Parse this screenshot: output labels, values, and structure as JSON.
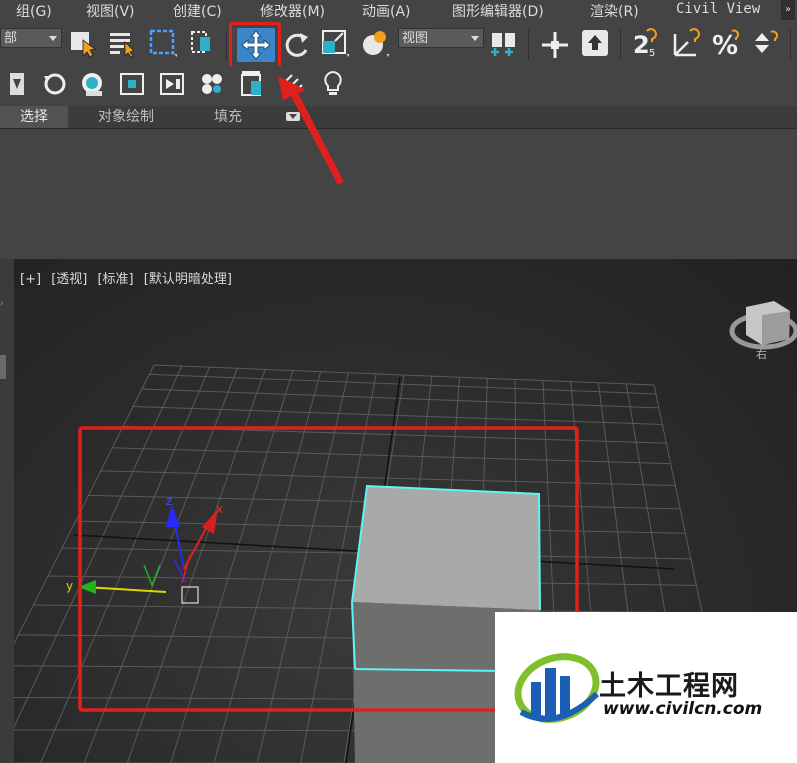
{
  "menu": {
    "items": [
      "组(G)",
      "视图(V)",
      "创建(C)",
      "修改器(M)",
      "动画(A)",
      "图形编辑器(D)",
      "渲染(R)",
      "Civil View"
    ],
    "more": "»"
  },
  "toolbar": {
    "selection_filter": "部",
    "view_dropdown": "视图"
  },
  "ribbon": {
    "tabs": [
      "选择",
      "对象绘制",
      "填充"
    ]
  },
  "viewport": {
    "labels": [
      "[+]",
      "[透视]",
      "[标准]",
      "[默认明暗处理]"
    ],
    "axis_x": "x",
    "axis_y": "y",
    "axis_z": "z",
    "viewcube_label": "右"
  },
  "watermark": {
    "title": "土木工程网",
    "url": "www.civilcn.com"
  },
  "colors": {
    "highlight": "#e0201c",
    "selection": "#5ff3f3",
    "active_tool": "#3a86c8"
  }
}
